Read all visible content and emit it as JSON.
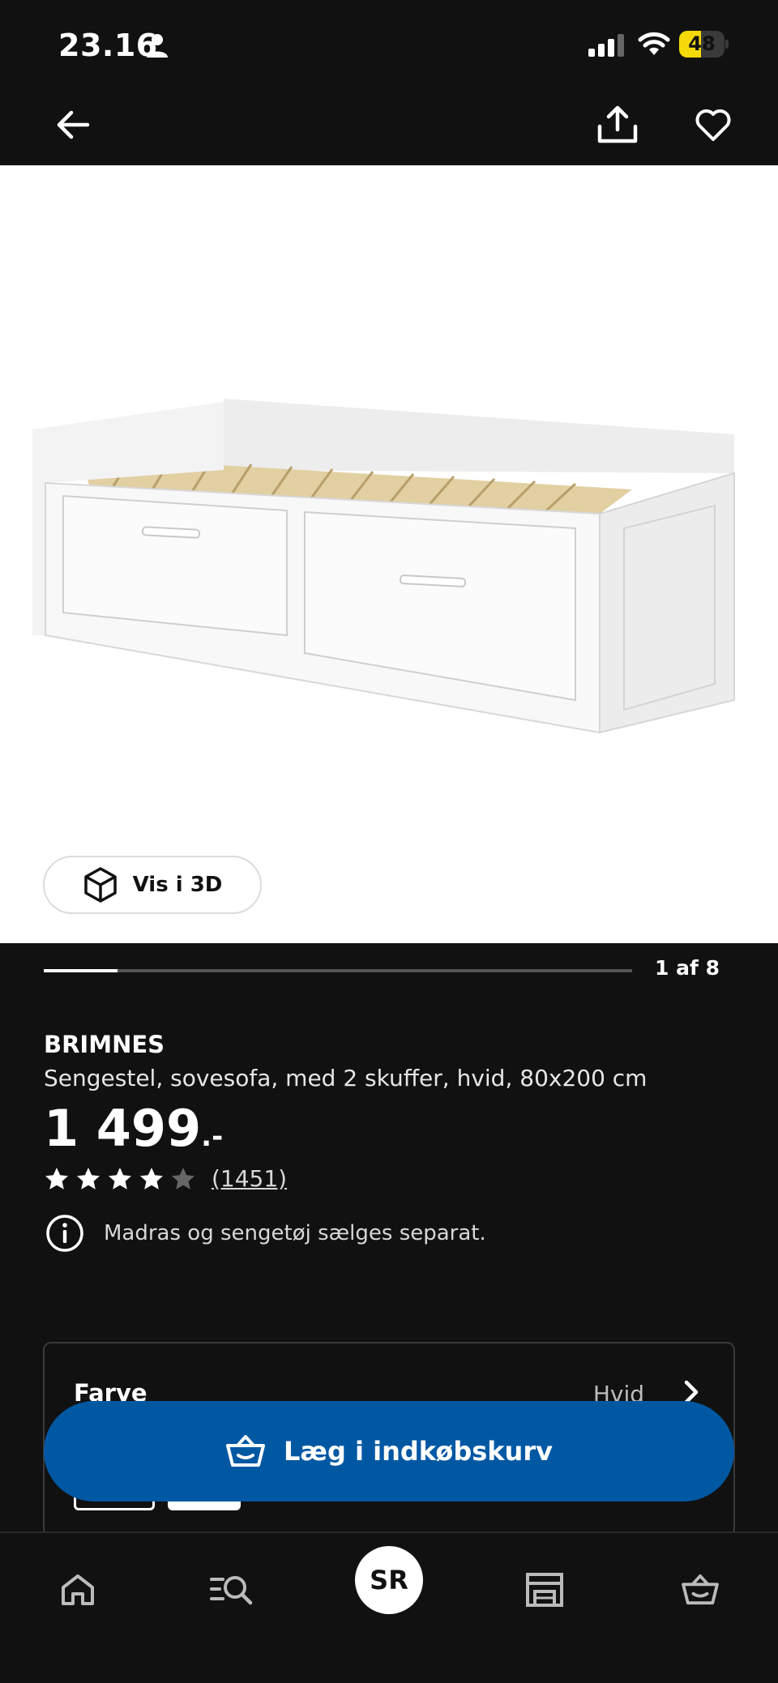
{
  "status_bar": {
    "time": "23.16",
    "battery": "48",
    "battery_level": 0.48
  },
  "nav": {
    "back_icon": "arrow-left-icon",
    "share_icon": "share-icon",
    "favorite_icon": "heart-icon"
  },
  "gallery": {
    "view_3d_label": "Vis i 3D",
    "counter": "1 af 8",
    "current_image": 1,
    "total_images": 8
  },
  "product": {
    "name": "BRIMNES",
    "description": "Sengestel, sovesofa, med 2 skuffer, hvid, 80x200 cm",
    "price": "1 499",
    "price_suffix": ".-",
    "rating": 4,
    "rating_max": 5,
    "review_count": "(1451)",
    "info_text": "Madras og sengetøj sælges separat."
  },
  "options": {
    "color_label": "Farve",
    "color_value": "Hvid"
  },
  "cart_button": {
    "label": "Læg i indkøbskurv"
  },
  "bottom_nav": {
    "avatar_initials": "SR",
    "tabs": [
      "home-icon",
      "search-list-icon",
      "profile-avatar",
      "store-icon",
      "cart-icon"
    ]
  },
  "colors": {
    "background": "#111111",
    "accent_blue": "#0058a3",
    "battery_yellow": "#f5d90a"
  }
}
